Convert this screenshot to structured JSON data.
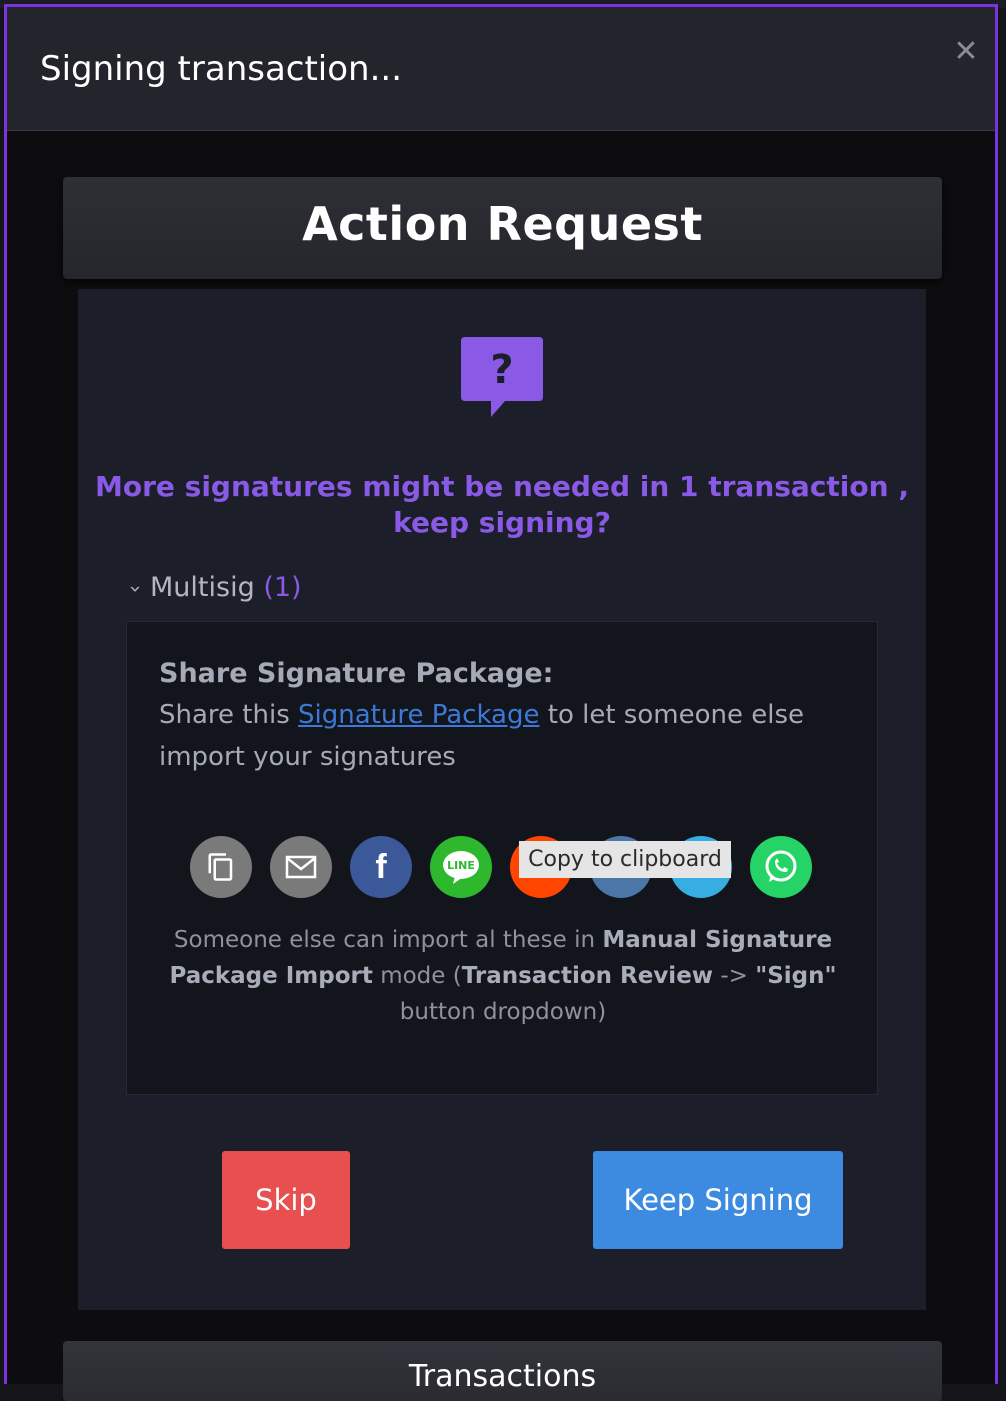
{
  "modal": {
    "title": "Signing transaction...",
    "close_icon": "close-icon"
  },
  "action_request": {
    "title": "Action Request",
    "icon": "question-bubble-icon",
    "prompt": "More signatures might be needed in 1 transaction , keep signing?",
    "multisig": {
      "label": "Multisig",
      "count": "(1)"
    },
    "share": {
      "heading": "Share Signature Package:",
      "desc_before": "Share this",
      "link": "Signature Package",
      "desc_after": "to let someone else import your signatures",
      "icons": [
        "copy-icon",
        "email-icon",
        "facebook-icon",
        "line-icon",
        "reddit-icon",
        "vk-icon",
        "telegram-icon",
        "whatsapp-icon"
      ],
      "tooltip": "Copy to clipboard",
      "import_note": {
        "t1": "Someone else can import al these in",
        "b1": "Manual Signature Package Import",
        "t2": "mode (",
        "b2": "Transaction Review",
        "t3": "->",
        "b3": "\"Sign\"",
        "t4": "button dropdown)"
      }
    },
    "buttons": {
      "skip": "Skip",
      "keep": "Keep Signing"
    }
  },
  "transactions": {
    "title": "Transactions"
  },
  "colors": {
    "accent": "#8a5ae6",
    "border": "#7b33e0",
    "skip": "#e85050",
    "keep": "#3d8be0",
    "link": "#3c79d9"
  }
}
